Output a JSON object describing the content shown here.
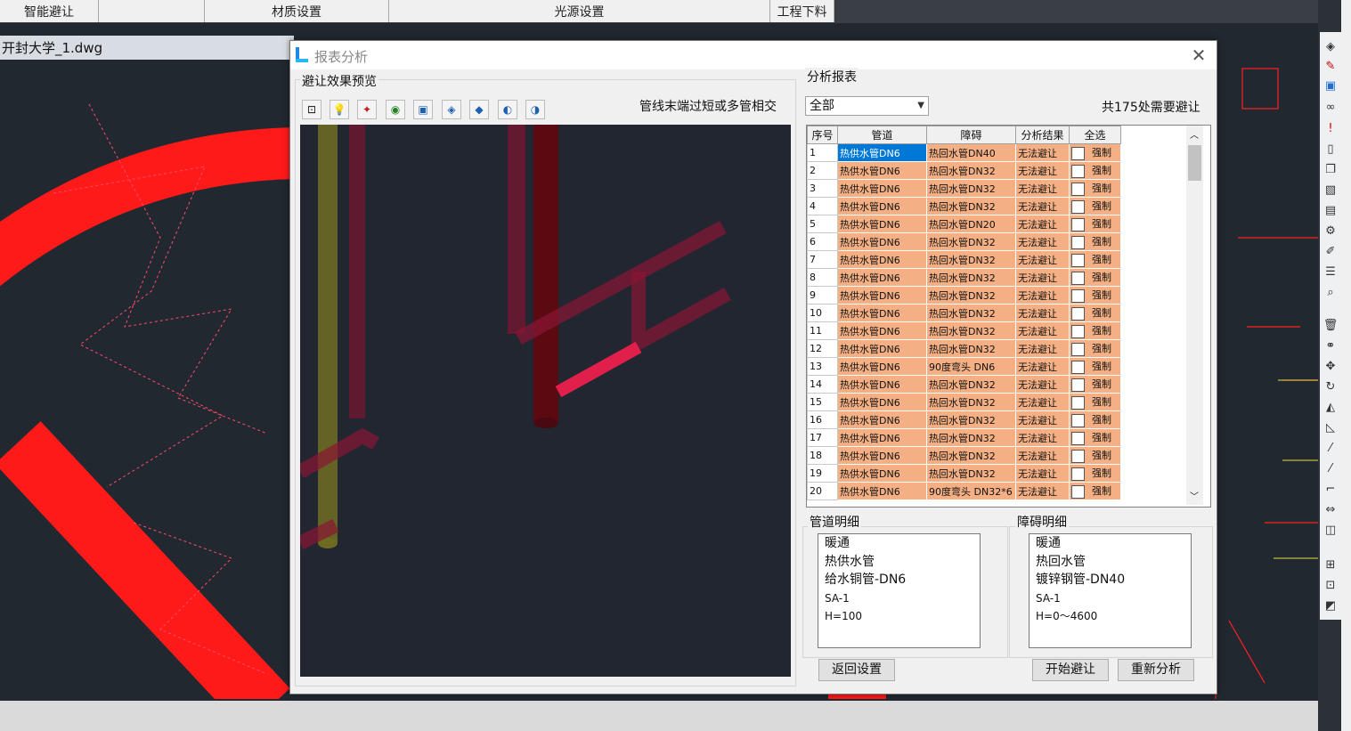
{
  "app": {
    "tabs": [
      "智能避让",
      "材质设置",
      "光源设置",
      "工程下料"
    ],
    "document_tab": "开封大学_1.dwg"
  },
  "dialog": {
    "title": "报表分析",
    "preview_group_label": "避让效果预览",
    "status_message": "管线末端过短或多管相交",
    "toolbar_icons": [
      "zoom-window-icon",
      "light-bulb-icon",
      "pipe-edit-icon",
      "eye-icon",
      "zoom-extents-icon",
      "cube-front-icon",
      "cube-back-icon",
      "cube-left-icon",
      "cube-right-icon"
    ],
    "report_group_label": "分析报表",
    "filter_value": "全部",
    "summary": "共175处需要避让",
    "table": {
      "headers": [
        "序号",
        "管道",
        "障碍",
        "分析结果",
        "全选"
      ],
      "force_label": "强制",
      "rows": [
        {
          "no": "1",
          "pipe": "热供水管DN6",
          "obstacle": "热回水管DN40",
          "result": "无法避让"
        },
        {
          "no": "2",
          "pipe": "热供水管DN6",
          "obstacle": "热回水管DN32",
          "result": "无法避让"
        },
        {
          "no": "3",
          "pipe": "热供水管DN6",
          "obstacle": "热回水管DN32",
          "result": "无法避让"
        },
        {
          "no": "4",
          "pipe": "热供水管DN6",
          "obstacle": "热回水管DN32",
          "result": "无法避让"
        },
        {
          "no": "5",
          "pipe": "热供水管DN6",
          "obstacle": "热回水管DN20",
          "result": "无法避让"
        },
        {
          "no": "6",
          "pipe": "热供水管DN6",
          "obstacle": "热回水管DN32",
          "result": "无法避让"
        },
        {
          "no": "7",
          "pipe": "热供水管DN6",
          "obstacle": "热回水管DN32",
          "result": "无法避让"
        },
        {
          "no": "8",
          "pipe": "热供水管DN6",
          "obstacle": "热回水管DN32",
          "result": "无法避让"
        },
        {
          "no": "9",
          "pipe": "热供水管DN6",
          "obstacle": "热回水管DN32",
          "result": "无法避让"
        },
        {
          "no": "10",
          "pipe": "热供水管DN6",
          "obstacle": "热回水管DN32",
          "result": "无法避让"
        },
        {
          "no": "11",
          "pipe": "热供水管DN6",
          "obstacle": "热回水管DN32",
          "result": "无法避让"
        },
        {
          "no": "12",
          "pipe": "热供水管DN6",
          "obstacle": "热回水管DN32",
          "result": "无法避让"
        },
        {
          "no": "13",
          "pipe": "热供水管DN6",
          "obstacle": "90度弯头 DN6",
          "result": "无法避让"
        },
        {
          "no": "14",
          "pipe": "热供水管DN6",
          "obstacle": "热回水管DN32",
          "result": "无法避让"
        },
        {
          "no": "15",
          "pipe": "热供水管DN6",
          "obstacle": "热回水管DN32",
          "result": "无法避让"
        },
        {
          "no": "16",
          "pipe": "热供水管DN6",
          "obstacle": "热回水管DN32",
          "result": "无法避让"
        },
        {
          "no": "17",
          "pipe": "热供水管DN6",
          "obstacle": "热回水管DN32",
          "result": "无法避让"
        },
        {
          "no": "18",
          "pipe": "热供水管DN6",
          "obstacle": "热回水管DN32",
          "result": "无法避让"
        },
        {
          "no": "19",
          "pipe": "热供水管DN6",
          "obstacle": "热回水管DN32",
          "result": "无法避让"
        },
        {
          "no": "20",
          "pipe": "热供水管DN6",
          "obstacle": "90度弯头 DN32*6",
          "result": "无法避让"
        }
      ]
    },
    "pipe_detail": {
      "label": "管道明细",
      "lines": [
        "暖通",
        "热供水管",
        "给水铜管-DN6",
        "SA-1",
        "H=100"
      ]
    },
    "obstacle_detail": {
      "label": "障碍明细",
      "lines": [
        "暖通",
        "热回水管",
        "镀锌钢管-DN40",
        "SA-1",
        "H=0～4600"
      ]
    },
    "buttons": {
      "back": "返回设置",
      "start": "开始避让",
      "reanalyze": "重新分析"
    }
  },
  "colors": {
    "cad_background": "#212830",
    "cell_highlight": "#f4b084",
    "selection": "#0078d7",
    "pipe_red": "#ff1a1a"
  }
}
